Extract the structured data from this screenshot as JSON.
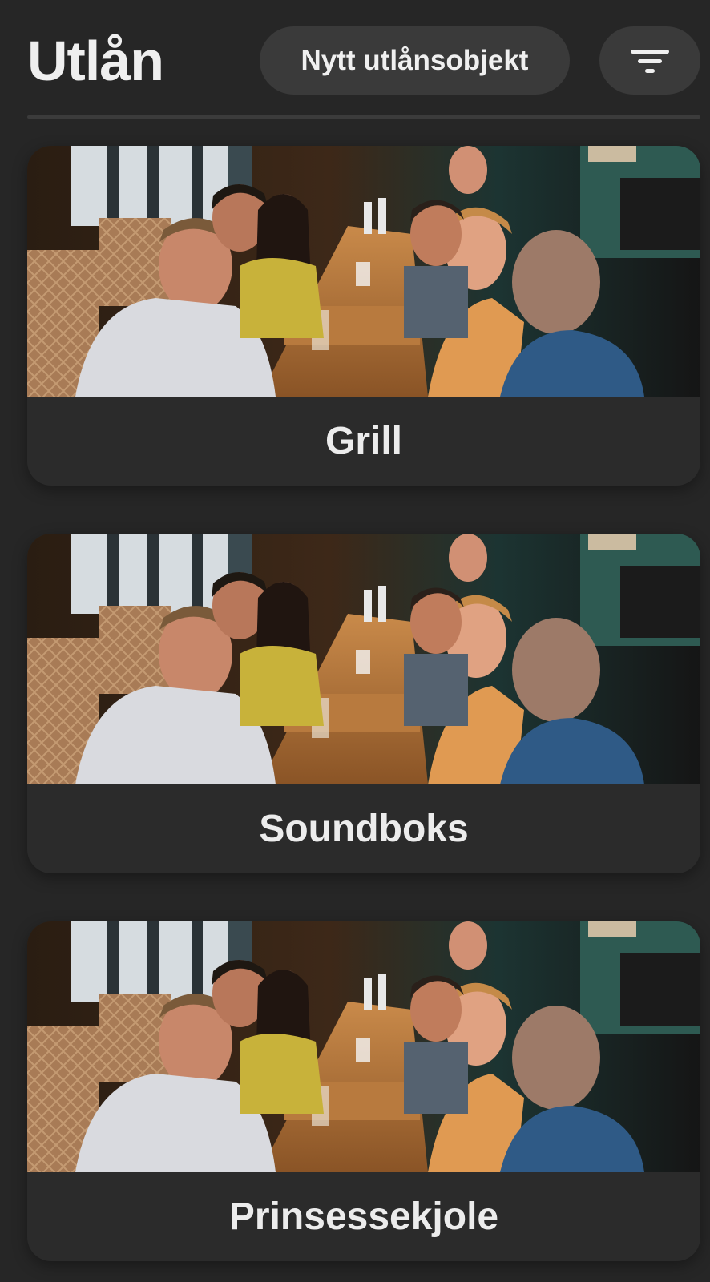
{
  "header": {
    "title": "Utlån",
    "new_item_label": "Nytt utlånsobjekt",
    "filter_icon": "filter-icon"
  },
  "items": [
    {
      "label": "Grill",
      "image": "restaurant-group-photo"
    },
    {
      "label": "Soundboks",
      "image": "restaurant-group-photo"
    },
    {
      "label": "Prinsessekjole",
      "image": "restaurant-group-photo"
    }
  ],
  "colors": {
    "background": "#262626",
    "card": "#2b2b2b",
    "button": "#3a3a3a",
    "text": "#ededed"
  }
}
